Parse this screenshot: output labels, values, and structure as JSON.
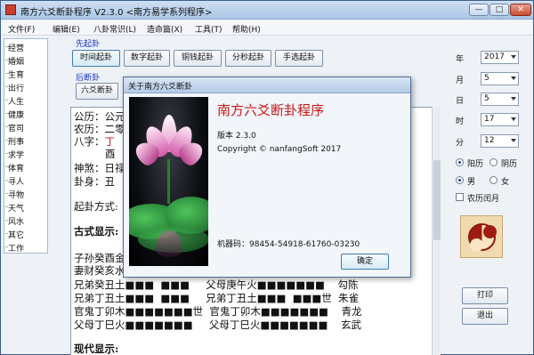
{
  "window": {
    "title": "南方六爻断卦程序 V2.3.0    <南方易学系列程序>",
    "controls": [
      "—",
      "□",
      "✕"
    ]
  },
  "menu": [
    "文件(F)",
    "编辑(E)",
    "八卦常识(L)",
    "造命篇(X)",
    "工具(T)",
    "帮助(H)"
  ],
  "sidebar": {
    "items": [
      "经营",
      "婚姻",
      "生育",
      "出行",
      "人生",
      "健康",
      "官司",
      "刑事",
      "求学",
      "体育",
      "寻人",
      "寻物",
      "天气",
      "风水",
      "其它",
      "工作"
    ]
  },
  "qigua": {
    "xian_label": "先起卦",
    "buttons": [
      "时间起卦",
      "数字起卦",
      "铜钱起卦",
      "分秒起卦",
      "手选起卦"
    ],
    "hou_label": "后断卦",
    "duan_button": "六爻断卦"
  },
  "content": {
    "lines": [
      {
        "text": "公历：公元",
        "cls": ""
      },
      {
        "text": "农历：二零",
        "cls": ""
      },
      {
        "text": "八字：丁",
        "cls": "bazi"
      },
      {
        "text": "酉",
        "cls": "red"
      },
      {
        "text": "神煞：日禄",
        "cls": ""
      },
      {
        "text": "卦身：丑",
        "cls": ""
      },
      {
        "text": "起卦方式:",
        "cls": ""
      },
      {
        "text": "古式显示:",
        "cls": "blue"
      },
      {
        "text": "子孙癸酉金",
        "cls": ""
      },
      {
        "text": "妻财癸亥水",
        "cls": ""
      },
      {
        "text": "兄弟癸丑土■■■  ■■■     父母庚午火■■■■■■■    勾陈",
        "cls": ""
      },
      {
        "text": "兄弟丁丑土■■■  ■■■     兄弟丁丑土■■■  ■■■世  朱雀",
        "cls": ""
      },
      {
        "text": "官鬼丁卯木■■■■■■■世  官鬼丁卯木■■■■■■■    青龙",
        "cls": ""
      },
      {
        "text": "父母丁巳火■■■■■■■     父母丁巳火■■■■■■■    玄武",
        "cls": ""
      },
      {
        "text": "现代显示:",
        "cls": "blue"
      }
    ]
  },
  "right_panel": {
    "fields": [
      {
        "label": "年",
        "value": "2017"
      },
      {
        "label": "月",
        "value": "5"
      },
      {
        "label": "日",
        "value": "5"
      },
      {
        "label": "时",
        "value": "17"
      },
      {
        "label": "分",
        "value": "12"
      }
    ],
    "calendar": {
      "solar": "阳历",
      "lunar": "阴历",
      "selected": "阳历"
    },
    "gender": {
      "male": "男",
      "female": "女",
      "selected": "男"
    },
    "leap_month": "农历闰月",
    "print_button": "打印",
    "exit_button": "退出"
  },
  "about_dialog": {
    "title": "关于南方六爻断卦",
    "app_name": "南方六爻断卦程序",
    "version": "版本 2.3.0",
    "copyright": "Copyright © nanfangSoft 2017",
    "machine_code": "机器码：98454-54918-61760-03230",
    "ok_button": "确定"
  },
  "colors": {
    "accent_red": "#c81818",
    "label_blue": "#1b35c9"
  }
}
